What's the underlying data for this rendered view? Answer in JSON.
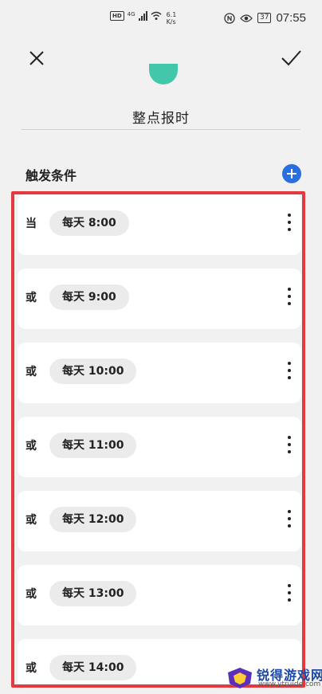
{
  "status_bar": {
    "hd": "HD",
    "network": "4G",
    "speed_value": "6.1",
    "speed_unit": "K/s",
    "battery": "37",
    "time": "07:55"
  },
  "header": {
    "title": "整点报时"
  },
  "triggers": {
    "label": "触发条件",
    "items": [
      {
        "prefix": "当",
        "condition": "每天 8:00"
      },
      {
        "prefix": "或",
        "condition": "每天 9:00"
      },
      {
        "prefix": "或",
        "condition": "每天 10:00"
      },
      {
        "prefix": "或",
        "condition": "每天 11:00"
      },
      {
        "prefix": "或",
        "condition": "每天 12:00"
      },
      {
        "prefix": "或",
        "condition": "每天 13:00"
      },
      {
        "prefix": "或",
        "condition": "每天 14:00"
      }
    ]
  },
  "watermark": {
    "brand": "锐得游戏网",
    "url": "www.ytruide.com"
  },
  "colors": {
    "accent_blue": "#2a6fe0",
    "highlight_red": "#e23a3f",
    "teal": "#43c7ab"
  }
}
